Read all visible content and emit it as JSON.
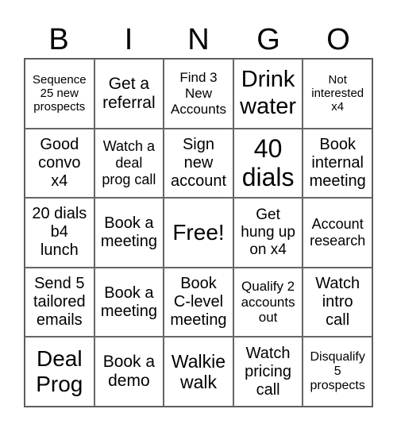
{
  "header": [
    "B",
    "I",
    "N",
    "G",
    "O"
  ],
  "cells": [
    "Sequence\n25 new\nprospects",
    "Get a\nreferral",
    "Find 3\nNew\nAccounts",
    "Drink\nwater",
    "Not\ninterested\nx4",
    "Good\nconvo\nx4",
    "Watch a\ndeal\nprog call",
    "Sign\nnew\naccount",
    "40\ndials",
    "Book\ninternal\nmeeting",
    "20 dials\nb4\nlunch",
    "Book a\nmeeting",
    "Free!",
    "Get\nhung up\non x4",
    "Account\nresearch",
    "Send 5\ntailored\nemails",
    "Book a\nmeeting",
    "Book\nC-level\nmeeting",
    "Qualify 2\naccounts\nout",
    "Watch\nintro\ncall",
    "Deal\nProg",
    "Book a\ndemo",
    "Walkie\nwalk",
    "Watch\npricing\ncall",
    "Disqualify\n5\nprospects"
  ]
}
